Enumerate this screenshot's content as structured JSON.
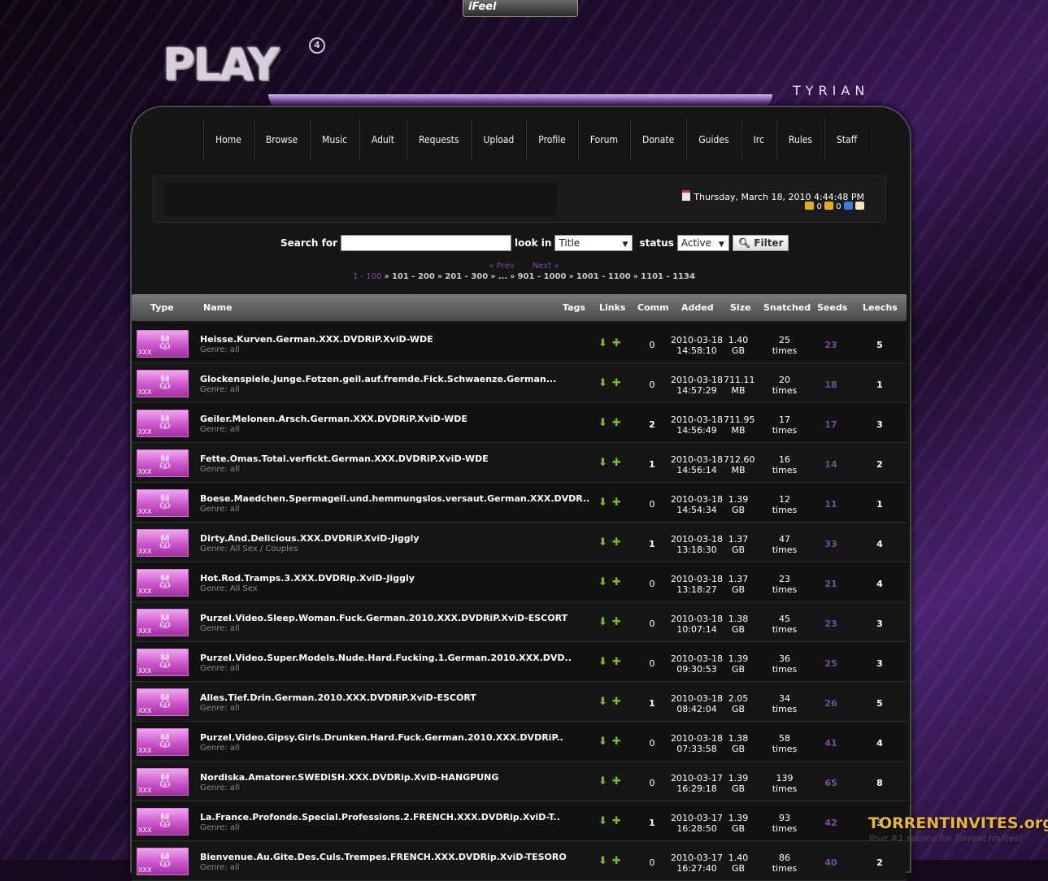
{
  "header": {
    "top_tab": "iFeel",
    "logo": "PLAY",
    "logo_sup": "4",
    "theme": "TYRIAN"
  },
  "nav": [
    "Home",
    "Browse",
    "Music",
    "Adult",
    "Requests",
    "Upload",
    "Profile",
    "Forum",
    "Donate",
    "Guides",
    "Irc",
    "Rules",
    "Staff"
  ],
  "info": {
    "datetime": "Thursday, March 18, 2010 4:44:48 PM",
    "stat_a": "0",
    "stat_b": "0"
  },
  "search": {
    "label": "Search for",
    "value": "",
    "lookin_label": "look in",
    "lookin_value": "Title",
    "status_label": "status",
    "status_value": "Active",
    "filter_label": "Filter"
  },
  "pager": {
    "prev": "« Prev",
    "next": "Next »",
    "pages": [
      "1 - 100",
      "101 - 200",
      "201 - 300",
      "...",
      "901 - 1000",
      "1001 - 1100",
      "1101 - 1134"
    ]
  },
  "columns": [
    "Type",
    "Name",
    "Tags",
    "Links",
    "Comm",
    "Added",
    "Size",
    "Snatched",
    "Seeds",
    "Leechs"
  ],
  "torrents": [
    {
      "type": "XXX",
      "name": "Heisse.Kurven.German.XXX.DVDRiP.XviD-WDE",
      "genre": "Genre: all",
      "comm": "0",
      "date": "2010-03-18",
      "time": "14:58:10",
      "size": "1.40",
      "unit": "GB",
      "snatched": "25",
      "times": "times",
      "seeds": "23",
      "leechs": "5"
    },
    {
      "type": "XXX",
      "name": "Glockenspiele.Junge.Fotzen.geil.auf.fremde.Fick.Schwaenze.German...",
      "genre": "Genre: all",
      "comm": "0",
      "date": "2010-03-18",
      "time": "14:57:29",
      "size": "711.11",
      "unit": "MB",
      "snatched": "20",
      "times": "times",
      "seeds": "18",
      "leechs": "1"
    },
    {
      "type": "XXX",
      "name": "Geiler.Melonen.Arsch.German.XXX.DVDRiP.XviD-WDE",
      "genre": "Genre: all",
      "comm": "2",
      "date": "2010-03-18",
      "time": "14:56:49",
      "size": "711.95",
      "unit": "MB",
      "snatched": "17",
      "times": "times",
      "seeds": "17",
      "leechs": "3"
    },
    {
      "type": "XXX",
      "name": "Fette.Omas.Total.verfickt.German.XXX.DVDRiP.XviD-WDE",
      "genre": "Genre: all",
      "comm": "1",
      "date": "2010-03-18",
      "time": "14:56:14",
      "size": "712.60",
      "unit": "MB",
      "snatched": "16",
      "times": "times",
      "seeds": "14",
      "leechs": "2"
    },
    {
      "type": "XXX",
      "name": "Boese.Maedchen.Spermageil.und.hemmungslos.versaut.German.XXX.DVDR..",
      "genre": "Genre: all",
      "comm": "0",
      "date": "2010-03-18",
      "time": "14:54:34",
      "size": "1.39",
      "unit": "GB",
      "snatched": "12",
      "times": "times",
      "seeds": "11",
      "leechs": "1"
    },
    {
      "type": "XXX",
      "name": "Dirty.And.Delicious.XXX.DVDRiP.XviD-Jiggly",
      "genre": "Genre: All Sex / Couples",
      "comm": "1",
      "date": "2010-03-18",
      "time": "13:18:30",
      "size": "1.37",
      "unit": "GB",
      "snatched": "47",
      "times": "times",
      "seeds": "33",
      "leechs": "4"
    },
    {
      "type": "XXX",
      "name": "Hot.Rod.Tramps.3.XXX.DVDRip.XviD-Jiggly",
      "genre": "Genre: All Sex",
      "comm": "0",
      "date": "2010-03-18",
      "time": "13:18:27",
      "size": "1.37",
      "unit": "GB",
      "snatched": "23",
      "times": "times",
      "seeds": "21",
      "leechs": "4"
    },
    {
      "type": "XXX",
      "name": "Purzel.Video.Sleep.Woman.Fuck.German.2010.XXX.DVDRiP.XviD-ESCORT",
      "genre": "Genre: all",
      "comm": "0",
      "date": "2010-03-18",
      "time": "10:07:14",
      "size": "1.38",
      "unit": "GB",
      "snatched": "45",
      "times": "times",
      "seeds": "23",
      "leechs": "3"
    },
    {
      "type": "XXX",
      "name": "Purzel.Video.Super.Models.Nude.Hard.Fucking.1.German.2010.XXX.DVD..",
      "genre": "Genre: all",
      "comm": "0",
      "date": "2010-03-18",
      "time": "09:30:53",
      "size": "1.39",
      "unit": "GB",
      "snatched": "36",
      "times": "times",
      "seeds": "25",
      "leechs": "3"
    },
    {
      "type": "XXX",
      "name": "Alles.Tief.Drin.German.2010.XXX.DVDRiP.XviD-ESCORT",
      "genre": "Genre: all",
      "comm": "1",
      "date": "2010-03-18",
      "time": "08:42:04",
      "size": "2.05",
      "unit": "GB",
      "snatched": "34",
      "times": "times",
      "seeds": "26",
      "leechs": "5"
    },
    {
      "type": "XXX",
      "name": "Purzel.Video.Gipsy.Girls.Drunken.Hard.Fuck.German.2010.XXX.DVDRiP..",
      "genre": "Genre: all",
      "comm": "0",
      "date": "2010-03-18",
      "time": "07:33:58",
      "size": "1.38",
      "unit": "GB",
      "snatched": "58",
      "times": "times",
      "seeds": "41",
      "leechs": "4"
    },
    {
      "type": "XXX",
      "name": "Nordiska.Amatorer.SWEDiSH.XXX.DVDRip.XviD-HANGPUNG",
      "genre": "Genre: all",
      "comm": "0",
      "date": "2010-03-17",
      "time": "16:29:18",
      "size": "1.39",
      "unit": "GB",
      "snatched": "139",
      "times": "times",
      "seeds": "65",
      "leechs": "8"
    },
    {
      "type": "XXX",
      "name": "La.France.Profonde.Special.Professions.2.FRENCH.XXX.DVDRip.XviD-T..",
      "genre": "Genre: all",
      "comm": "1",
      "date": "2010-03-17",
      "time": "16:28:50",
      "size": "1.39",
      "unit": "GB",
      "snatched": "93",
      "times": "times",
      "seeds": "42",
      "leechs": "3"
    },
    {
      "type": "XXX",
      "name": "Bienvenue.Au.Gite.Des.Culs.Trempes.FRENCH.XXX.DVDRip.XviD-TESORO",
      "genre": "Genre: all",
      "comm": "0",
      "date": "2010-03-17",
      "time": "16:27:40",
      "size": "1.40",
      "unit": "GB",
      "snatched": "86",
      "times": "times",
      "seeds": "40",
      "leechs": "2"
    }
  ],
  "watermark": {
    "title": "TORRENTINVITES.org",
    "subtitle": "Your #1 source for Torrent Invites!"
  }
}
